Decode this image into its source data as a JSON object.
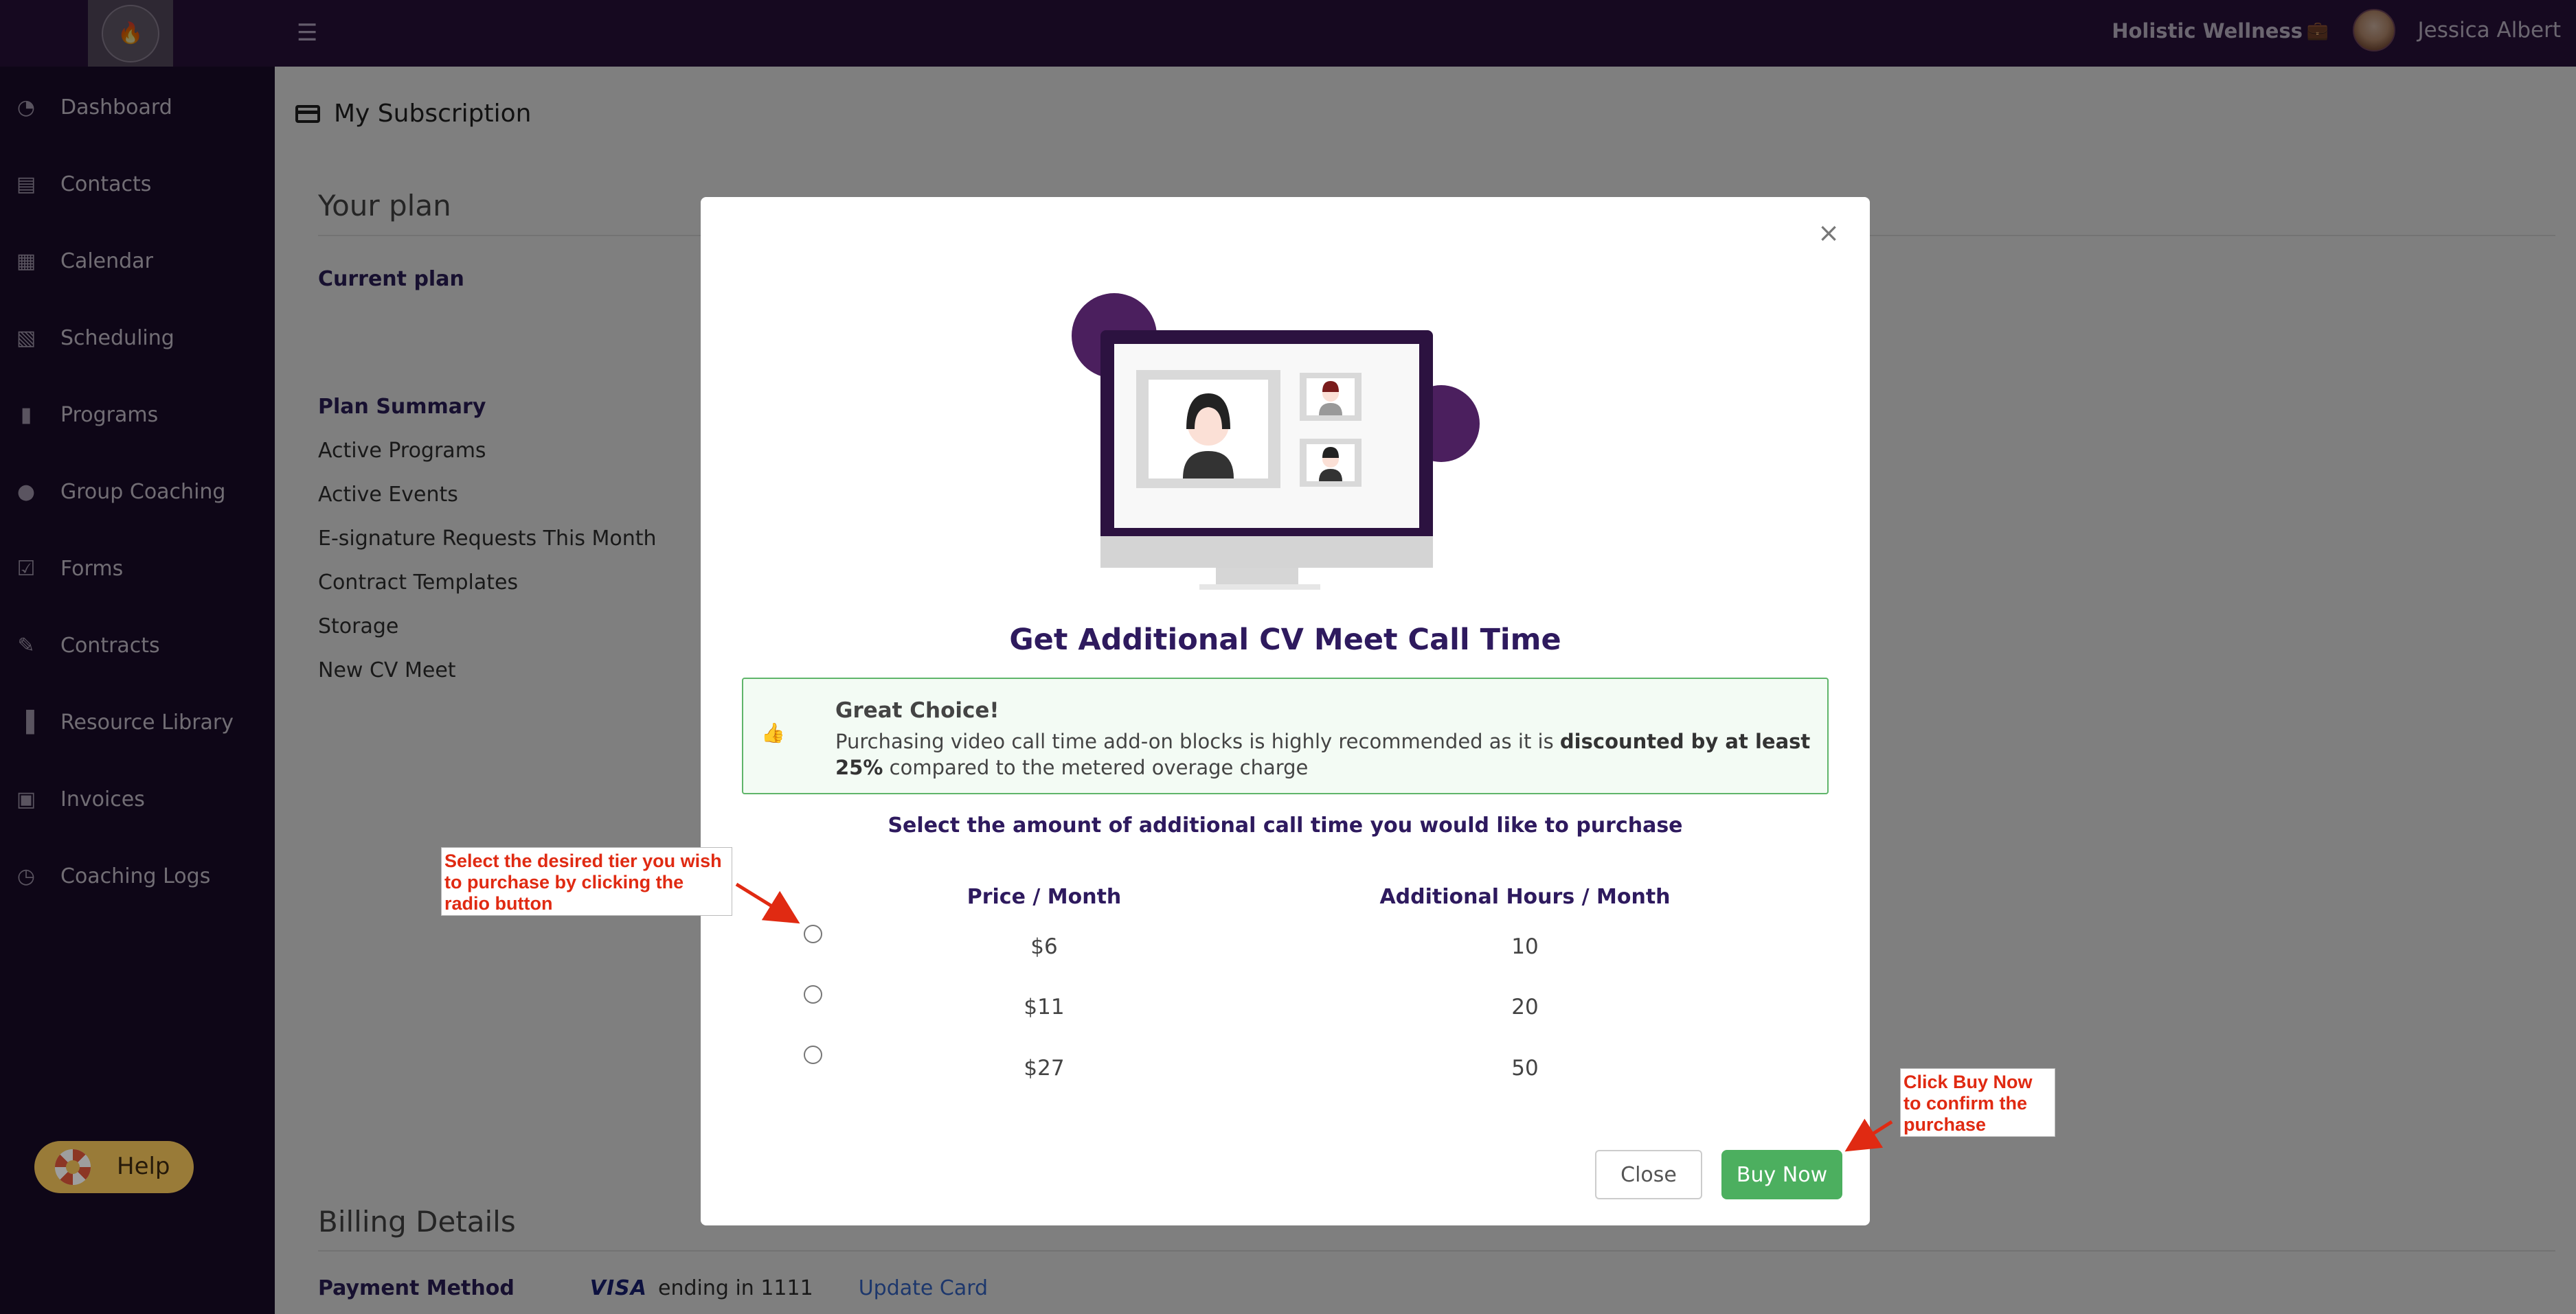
{
  "header": {
    "org_name": "Holistic Wellness",
    "user_name": "Jessica Albert",
    "icons": {
      "menu": "menu-collapse-icon",
      "briefcase": "briefcase-icon",
      "logo": "flame-logo-icon"
    }
  },
  "sidebar": {
    "items": [
      {
        "label": "Dashboard",
        "icon": "gauge-icon"
      },
      {
        "label": "Contacts",
        "icon": "contact-card-icon"
      },
      {
        "label": "Calendar",
        "icon": "calendar-icon"
      },
      {
        "label": "Scheduling",
        "icon": "calendar-clock-icon"
      },
      {
        "label": "Programs",
        "icon": "book-icon"
      },
      {
        "label": "Group Coaching",
        "icon": "users-icon"
      },
      {
        "label": "Forms",
        "icon": "checklist-icon"
      },
      {
        "label": "Contracts",
        "icon": "signature-icon"
      },
      {
        "label": "Resource Library",
        "icon": "books-icon"
      },
      {
        "label": "Invoices",
        "icon": "invoice-icon"
      },
      {
        "label": "Coaching Logs",
        "icon": "clock-icon"
      }
    ],
    "help_label": "Help"
  },
  "page": {
    "title": "My Subscription",
    "your_plan_heading": "Your plan",
    "current_plan_label": "Current plan",
    "plan_summary_label": "Plan Summary",
    "plan_items": [
      "Active Programs",
      "Active Events",
      "E-signature Requests This Month",
      "Contract Templates",
      "Storage",
      "New CV Meet"
    ],
    "billing_heading": "Billing Details",
    "payment_method_label": "Payment Method",
    "card_brand": "VISA",
    "card_ending": "ending in 1111",
    "update_card_label": "Update Card"
  },
  "modal": {
    "title": "Get Additional CV Meet Call Time",
    "alert_title": "Great Choice!",
    "alert_text_before": "Purchasing video call time add-on blocks is highly recommended as it is ",
    "alert_text_bold": "discounted by at least 25%",
    "alert_text_after": " compared to the metered overage charge",
    "select_instruction": "Select the amount of additional call time you would like to purchase",
    "col_price": "Price / Month",
    "col_hours": "Additional Hours / Month",
    "tiers": [
      {
        "price": "$6",
        "hours": "10",
        "selected": false
      },
      {
        "price": "$11",
        "hours": "20",
        "selected": false
      },
      {
        "price": "$27",
        "hours": "50",
        "selected": false
      }
    ],
    "close_label": "Close",
    "buy_label": "Buy Now"
  },
  "callouts": {
    "select_tier": "Select the desired tier you wish to purchase by clicking the radio button",
    "buy_now": "Click Buy Now to confirm the purchase"
  },
  "colors": {
    "topbar": "#2c1240",
    "sidebar": "#1d0c2e",
    "modal_title": "#2e1a5e",
    "buy_button": "#4caf5f",
    "alert_border": "#5fb56a",
    "callout_text": "#e02a12",
    "help_button": "#f6c75a"
  }
}
